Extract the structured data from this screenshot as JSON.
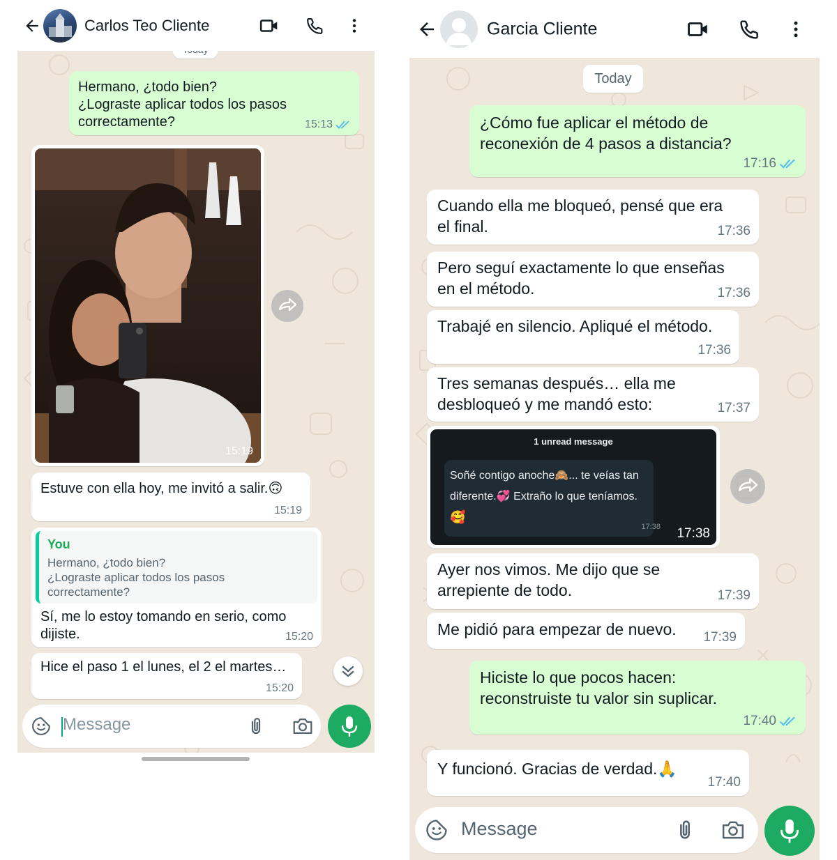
{
  "left": {
    "contact_name": "Carlos Teo Cliente",
    "date_pill": "Today",
    "messages": [
      {
        "text": "Hermano, ¿todo bien?\n¿Lograste aplicar todos los pasos\ncorrectamente?",
        "time": "15:13",
        "direction": "out",
        "status": "read"
      },
      {
        "type": "photo",
        "time": "15:19",
        "direction": "in"
      },
      {
        "text": "Estuve con ella hoy, me invitó a salir.",
        "emoji": "🙃",
        "time": "15:19",
        "direction": "in"
      },
      {
        "quote_author": "You",
        "quote_text": "Hermano, ¿todo bien?\n¿Lograste aplicar todos los pasos\ncorrectamente?",
        "text": "Sí, me lo estoy tomando en serio, como\ndijiste.",
        "time": "15:20",
        "direction": "in"
      },
      {
        "text": "Hice el paso 1 el lunes, el 2 el martes…",
        "time": "15:20",
        "direction": "in"
      }
    ],
    "composer_placeholder": "Message"
  },
  "right": {
    "contact_name": "Garcia Cliente",
    "date_pill": "Today",
    "messages": [
      {
        "text": "¿Cómo fue aplicar el método de\nreconexión de 4 pasos a distancia?",
        "time": "17:16",
        "direction": "out",
        "status": "read"
      },
      {
        "text": "Cuando ella me bloqueó, pensé que era\nel final.",
        "time": "17:36",
        "direction": "in"
      },
      {
        "text": "Pero seguí exactamente lo que enseñas\nen el método.",
        "time": "17:36",
        "direction": "in"
      },
      {
        "text": "Trabajé en silencio. Apliqué el método.",
        "time": "17:36",
        "direction": "in"
      },
      {
        "text": "Tres semanas después… ella me\ndesbloqueó y me mandó esto:",
        "time": "17:37",
        "direction": "in"
      },
      {
        "type": "screenshot",
        "time": "17:38",
        "direction": "in",
        "inner": {
          "unread_label": "1 unread message",
          "line1": "Soñé contigo anoche",
          "emoji1": "🙈",
          "line1_rest": "... te veías tan",
          "line2": "diferente.",
          "emoji2": "💞",
          "line2_rest": " Extraño lo que teníamos.",
          "emoji3": "🥰",
          "time": "17:38"
        }
      },
      {
        "text": "Ayer nos vimos. Me dijo que se\narrepiente de todo.",
        "time": "17:39",
        "direction": "in"
      },
      {
        "text": "Me pidió para empezar de nuevo.",
        "time": "17:39",
        "direction": "in"
      },
      {
        "text": "Hiciste lo que pocos hacen:\nreconstruiste tu valor sin suplicar.",
        "time": "17:40",
        "direction": "out",
        "status": "read"
      },
      {
        "text": "Y funcionó. Gracias de verdad.",
        "emoji": "🙏",
        "time": "17:40",
        "direction": "in"
      }
    ],
    "composer_placeholder": "Message"
  },
  "colors": {
    "outgoing": "#d9fdd3",
    "incoming": "#ffffff",
    "wallpaper": "#efe7dc",
    "accent": "#1daa61",
    "read_ticks": "#53bdeb",
    "quote_bar": "#06cf9c",
    "quote_author": "#1fa855"
  },
  "icons": [
    "back-arrow-icon",
    "video-call-icon",
    "voice-call-icon",
    "more-vert-icon",
    "forward-icon",
    "read-ticks-icon",
    "sticker-icon",
    "attach-icon",
    "camera-icon",
    "mic-icon",
    "scroll-down-icon"
  ]
}
